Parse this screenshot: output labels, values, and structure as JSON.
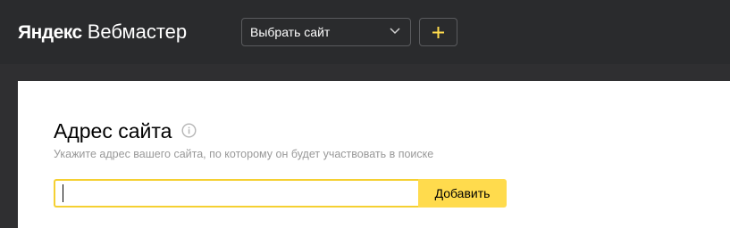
{
  "header": {
    "brand": "Яндекс",
    "product": "Вебмастер",
    "site_select": {
      "value": "Выбрать сайт",
      "icon": "chevron-down-icon"
    },
    "add_site_icon": "plus-icon"
  },
  "main": {
    "title": "Адрес сайта",
    "info_icon": "info-icon",
    "hint": "Укажите адрес вашего сайта, по которому он будет участвовать в поиске",
    "address_input": {
      "value": "",
      "placeholder": ""
    },
    "add_button_label": "Добавить"
  },
  "colors": {
    "topbar": "#2a2b2d",
    "accent_yellow": "#ffdb4d",
    "input_border": "#f5d032",
    "hint_text": "#999999"
  }
}
